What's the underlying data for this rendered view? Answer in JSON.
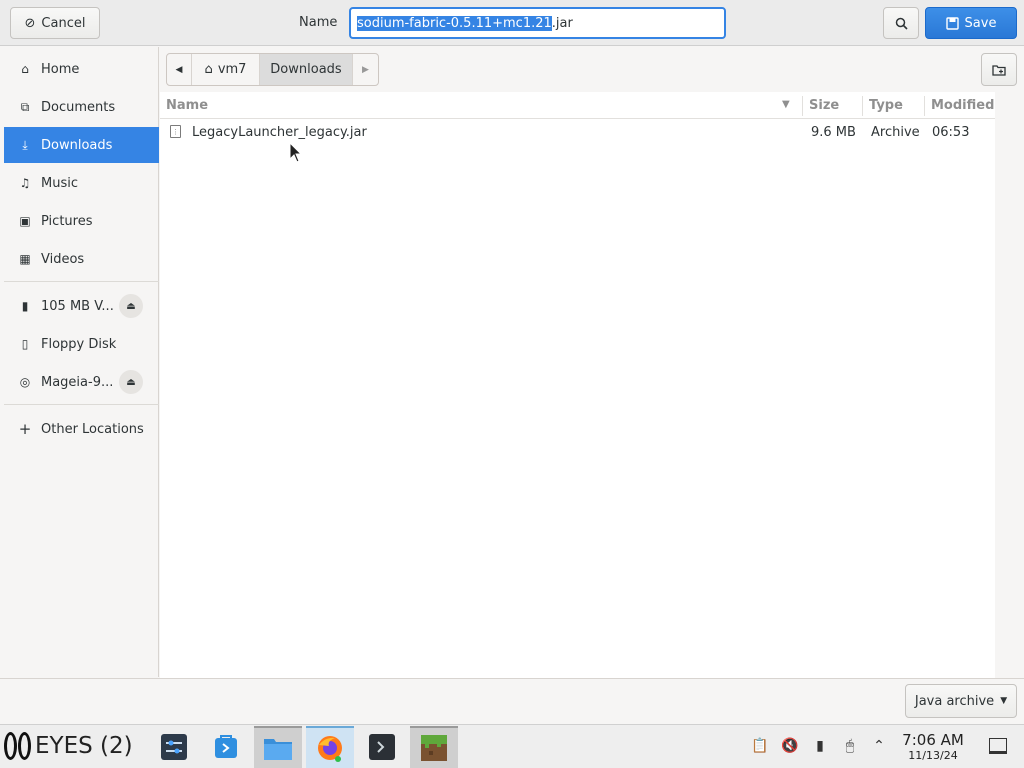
{
  "header": {
    "cancel_label": "Cancel",
    "name_label": "Name",
    "filename_selected": "sodium-fabric-0.5.11+mc1.21",
    "filename_rest": ".jar",
    "save_label": "Save"
  },
  "sidebar": {
    "items": [
      {
        "label": "Home",
        "icon": "home-icon"
      },
      {
        "label": "Documents",
        "icon": "documents-icon"
      },
      {
        "label": "Downloads",
        "icon": "downloads-icon",
        "active": true
      },
      {
        "label": "Music",
        "icon": "music-icon"
      },
      {
        "label": "Pictures",
        "icon": "pictures-icon"
      },
      {
        "label": "Videos",
        "icon": "videos-icon"
      }
    ],
    "devices": [
      {
        "label": "105 MB V...",
        "icon": "usb-drive-icon",
        "ejectable": true
      },
      {
        "label": "Floppy Disk",
        "icon": "floppy-icon",
        "ejectable": false
      },
      {
        "label": "Mageia-9...",
        "icon": "optical-disc-icon",
        "ejectable": true
      }
    ],
    "other_locations": "Other Locations"
  },
  "pathbar": {
    "segments": [
      "vm7",
      "Downloads"
    ]
  },
  "filelist": {
    "columns": [
      "Name",
      "Size",
      "Type",
      "Modified"
    ],
    "rows": [
      {
        "name": "LegacyLauncher_legacy.jar",
        "size": "9.6 MB",
        "type": "Archive",
        "modified": "06:53"
      }
    ]
  },
  "filter": {
    "selected": "Java archive"
  },
  "taskbar": {
    "eyes_label": "EYES (2)",
    "time": "7:06 AM",
    "date": "11/13/24",
    "tasks": [
      "settings-app-icon",
      "software-center-icon",
      "file-manager-icon",
      "firefox-icon",
      "terminal-icon",
      "minecraft-icon"
    ]
  },
  "colors": {
    "accent": "#3584e4",
    "header_bg": "#ebebeb",
    "sidebar_bg": "#f6f5f4"
  }
}
